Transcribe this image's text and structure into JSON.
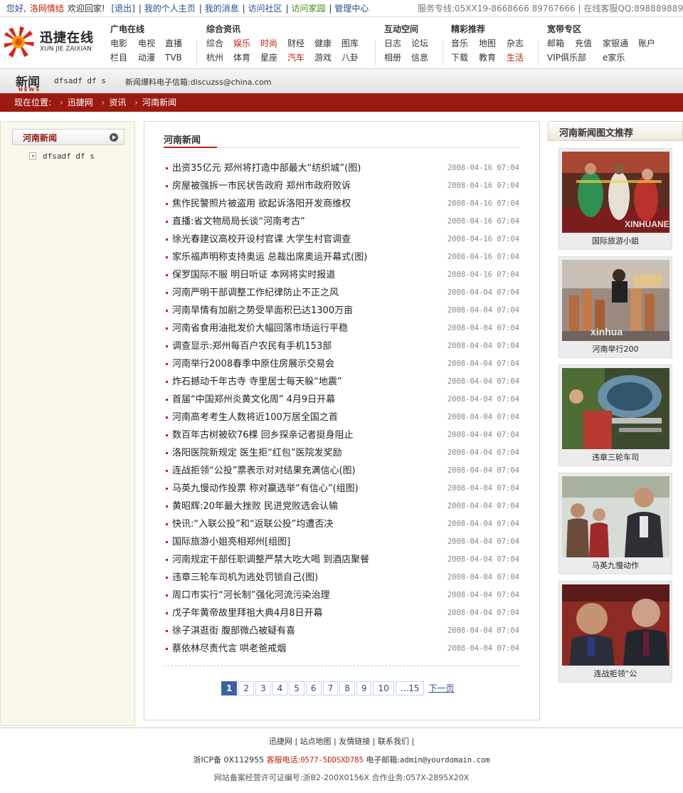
{
  "topbar": {
    "greeting": "您好,",
    "user": "洛网情结",
    "welcome": "欢迎回家!",
    "links": [
      "[退出]",
      "我的个人主页",
      "我的消息",
      "访问社区",
      "访问家园",
      "管理中心"
    ],
    "service": "服务专线:05XX19-8668666 89767666",
    "qq": "在线客服QQ:898889889"
  },
  "logo": {
    "cn": "迅捷在线",
    "en": "XUN JIE ZAIXIAN"
  },
  "nav": [
    {
      "title": "广电在线",
      "items": [
        "电影",
        "电视",
        "直播",
        "栏目",
        "动漫",
        "TVB"
      ],
      "highlight": []
    },
    {
      "title": "综合资讯",
      "items": [
        "综合",
        "娱乐",
        "时尚",
        "财经",
        "健康",
        "图库",
        "杭州",
        "体育",
        "星座",
        "汽车",
        "游戏",
        "八卦"
      ],
      "highlight": [
        "娱乐",
        "时尚",
        "汽车"
      ]
    },
    {
      "title": "互动空间",
      "items": [
        "日志",
        "论坛",
        "相册",
        "信息"
      ],
      "highlight": []
    },
    {
      "title": "精彩推荐",
      "items": [
        "音乐",
        "地图",
        "杂志",
        "下载",
        "教育",
        "生活"
      ],
      "highlight": [
        "生活"
      ]
    },
    {
      "title": "宽带专区",
      "items": [
        "邮箱",
        "充值",
        "家银通",
        "账户",
        "VIP俱乐部",
        "e家乐"
      ],
      "highlight": []
    }
  ],
  "newsbar": {
    "label": "新闻",
    "sub": "NEWS",
    "tag": "dfsadf df s",
    "email": "新闻爆料电子信箱:discuzss@china.com"
  },
  "breadcrumb": {
    "prefix": "现在位置:",
    "items": [
      "迅捷网",
      "资讯",
      "河南新闻"
    ]
  },
  "sidebar": {
    "title": "河南新闻",
    "sub": "dfsadf df s"
  },
  "main": {
    "title": "河南新闻",
    "news": [
      {
        "title": "出资35亿元 郑州将打造中部最大“纺织城”(图)",
        "date": "2008-04-16 07:04"
      },
      {
        "title": "房屋被强拆一市民状告政府 郑州市政府败诉",
        "date": "2008-04-16 07:04"
      },
      {
        "title": "焦作民警照片被盗用 欲起诉洛阳开发商维权",
        "date": "2008-04-16 07:04"
      },
      {
        "title": "直播:省文物局局长谈“河南考古”",
        "date": "2008-04-16 07:04"
      },
      {
        "title": "徐光春建议高校开设村官课 大学生村官调查",
        "date": "2008-04-16 07:04"
      },
      {
        "title": "家乐福声明称支持奥运 总裁出席奥运开幕式(图)",
        "date": "2008-04-16 07:04"
      },
      {
        "title": "保罗国际不服 明日听证 本网将实时报道",
        "date": "2008-04-16 07:04"
      },
      {
        "title": "河南严明干部调整工作纪律防止不正之风",
        "date": "2008-04-04 07:04"
      },
      {
        "title": "河南旱情有加剧之势受旱面积已达1300万亩",
        "date": "2008-04-04 07:04"
      },
      {
        "title": "河南省食用油批发价大幅回落市场运行平稳",
        "date": "2008-04-04 07:04"
      },
      {
        "title": "调查显示:郑州每百户农民有手机153部",
        "date": "2008-04-04 07:04"
      },
      {
        "title": "河南举行2008春季中原住房展示交易会",
        "date": "2008-04-04 07:04"
      },
      {
        "title": "炸石撼动千年古寺 寺里居士每天躲“地震”",
        "date": "2008-04-04 07:04"
      },
      {
        "title": "首届“中国郑州炎黄文化周” 4月9日开幕",
        "date": "2008-04-04 07:04"
      },
      {
        "title": "河南高考考生人数将近100万居全国之首",
        "date": "2008-04-04 07:04"
      },
      {
        "title": "数百年古树被砍76棵  回乡探亲记者挺身阻止",
        "date": "2008-04-04 07:04"
      },
      {
        "title": "洛阳医院新规定 医生拒“红包”医院发奖励",
        "date": "2008-04-04 07:04"
      },
      {
        "title": "连战拒领“公投”票表示对对结果充满信心(图)",
        "date": "2008-04-04 07:04"
      },
      {
        "title": "马英九慢动作投票 称对赢选举“有信心”(组图)",
        "date": "2008-04-04 07:04"
      },
      {
        "title": "黄昭辉:20年最大挫败 民进党败选会认输",
        "date": "2008-04-04 07:04"
      },
      {
        "title": "快讯:“入联公投”和“返联公投”均遭否决",
        "date": "2008-04-04 07:04"
      },
      {
        "title": "国际旅游小姐亮相郑州[组图]",
        "date": "2008-04-04 07:04"
      },
      {
        "title": "河南规定干部任职调整严禁大吃大喝 到酒店聚餐",
        "date": "2008-04-04 07:04"
      },
      {
        "title": "违章三轮车司机为逃处罚锁自己(图)",
        "date": "2008-04-04 07:04"
      },
      {
        "title": "周口市实行“河长制”强化河流污染治理",
        "date": "2008-04-04 07:04"
      },
      {
        "title": "戊子年黄帝故里拜祖大典4月8日开幕",
        "date": "2008-04-04 07:04"
      },
      {
        "title": "徐子淇逛街 腹部微凸被疑有喜",
        "date": "2008-04-04 07:04"
      },
      {
        "title": "蔡依林尽责代言 哄老爸戒烟",
        "date": "2008-04-04 07:04"
      }
    ],
    "pager": {
      "pages": [
        "1",
        "2",
        "3",
        "4",
        "5",
        "6",
        "7",
        "8",
        "9",
        "10",
        "...15"
      ],
      "current": "1",
      "next": "下一页"
    }
  },
  "right": {
    "title": "河南新闻图文推荐",
    "pics": [
      {
        "caption": "国际旅游小姐",
        "watermark": "XINHUANE"
      },
      {
        "caption": "河南举行200",
        "watermark": "xinhua"
      },
      {
        "caption": "违章三轮车司",
        "watermark": ""
      },
      {
        "caption": "马英九慢动作",
        "watermark": ""
      },
      {
        "caption": "连战拒领“公",
        "watermark": ""
      }
    ]
  },
  "footer": {
    "links": [
      "迅捷网",
      "站点地图",
      "友情链接",
      "联系我们"
    ],
    "icp": "浙ICP备 0X112955",
    "phone_label": "客服电话:",
    "phone": "0577-5DDSXD785",
    "email_label": "电子邮箱:",
    "email": "admin@yourdomain.com",
    "license": "网站备案经营许可证编号:浙B2-200X0156X 合作业务:057X-2895X20X"
  }
}
